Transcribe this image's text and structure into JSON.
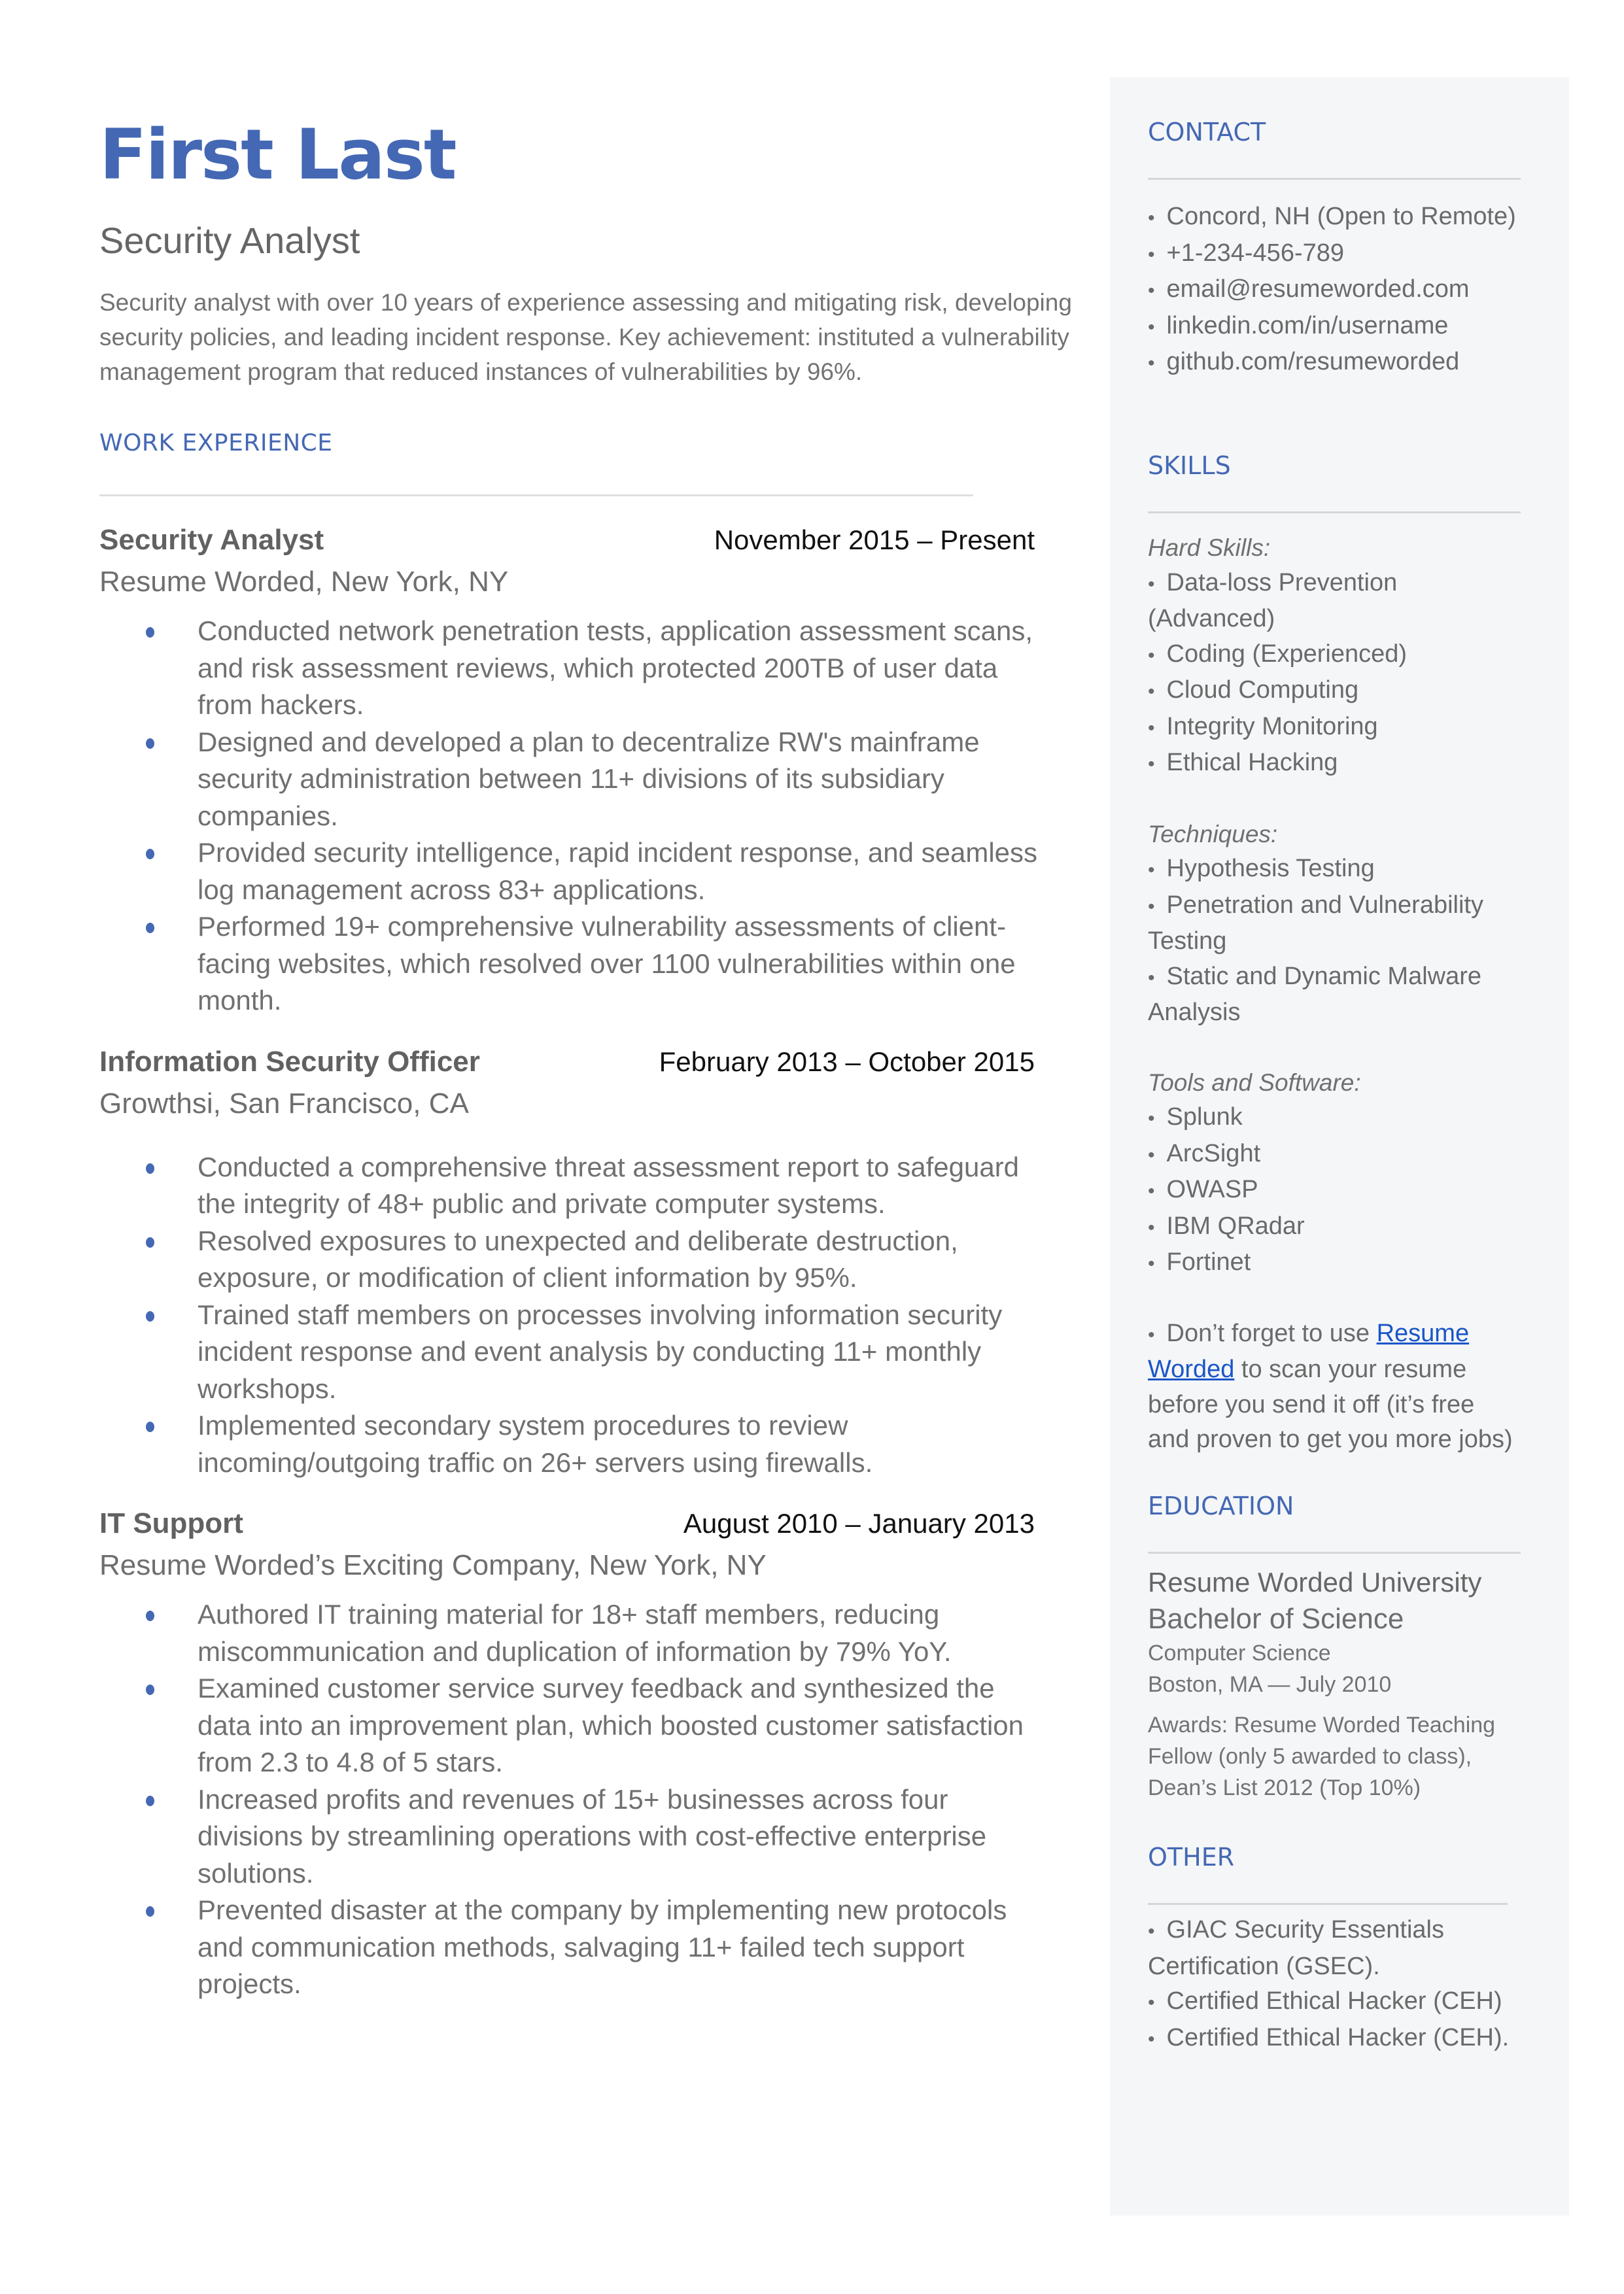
{
  "header": {
    "name": "First Last",
    "role": "Security Analyst",
    "summary": "Security analyst with over 10 years of experience assessing and mitigating risk, developing security policies, and leading incident response. Key achievement: instituted a vulnerability management program that reduced instances of vulnerabilities by 96%."
  },
  "colors": {
    "accent": "#4468b3",
    "sidebar_bg": "#f5f6f8",
    "link": "#1a56c8"
  },
  "work": {
    "title": "WORK EXPERIENCE",
    "jobs": [
      {
        "title": "Security Analyst",
        "dates": "November 2015 – Present",
        "company": "Resume Worded, New York, NY",
        "bullets": [
          "Conducted network penetration tests, application assessment scans, and risk assessment reviews, which protected 200TB of user data from hackers.",
          "Designed and developed a plan to decentralize RW's mainframe security administration between 11+ divisions of its subsidiary companies.",
          "Provided security intelligence, rapid incident response, and seamless log management across 83+ applications.",
          "Performed 19+ comprehensive vulnerability assessments of client-facing websites, which resolved over 1100 vulnerabilities within one month."
        ]
      },
      {
        "title": "Information Security Officer",
        "dates": "February 2013 – October 2015",
        "company": "Growthsi, San Francisco, CA",
        "bullets": [
          "Conducted a comprehensive threat assessment report to safeguard the integrity of 48+ public and private computer systems.",
          "Resolved exposures to unexpected and deliberate destruction, exposure, or modification of client information by 95%.",
          "Trained staff members on processes involving information security incident response and event analysis by conducting 11+ monthly workshops.",
          "Implemented secondary system procedures to review incoming/outgoing traffic on 26+ servers using firewalls."
        ]
      },
      {
        "title": "IT Support",
        "dates": "August 2010 – January 2013",
        "company": "Resume Worded’s Exciting Company, New York, NY",
        "bullets": [
          "Authored IT training material for 18+ staff members, reducing miscommunication and duplication of information by 79% YoY.",
          "Examined customer service survey feedback and synthesized the data into an improvement plan, which boosted customer satisfaction from 2.3 to 4.8 of 5 stars.",
          "Increased profits and revenues of 15+ businesses across four divisions by streamlining operations with cost-effective enterprise solutions.",
          "Prevented disaster at the company by implementing new protocols and communication methods, salvaging 11+ failed tech support projects."
        ]
      }
    ]
  },
  "contact": {
    "title": "CONTACT",
    "items": [
      "Concord, NH (Open to Remote)",
      "+1-234-456-789",
      "email@resumeworded.com",
      "linkedin.com/in/username",
      "github.com/resumeworded"
    ]
  },
  "skills": {
    "title": "SKILLS",
    "hard_label": "Hard Skills:",
    "hard": [
      "Data-loss Prevention (Advanced)",
      "Coding (Experienced)",
      "Cloud Computing",
      "Integrity Monitoring",
      "Ethical Hacking"
    ],
    "techniques_label": "Techniques:",
    "techniques": [
      "Hypothesis Testing",
      "Penetration and Vulnerability Testing",
      "Static and Dynamic Malware Analysis"
    ],
    "tools_label": "Tools and Software:",
    "tools": [
      "Splunk",
      "ArcSight",
      "OWASP",
      "IBM QRadar",
      "Fortinet"
    ],
    "tip_prefix": "Don’t forget to use ",
    "tip_link": "Resume Worded",
    "tip_suffix": " to scan your resume before you send it off (it’s free and proven to get you more jobs)"
  },
  "education": {
    "title": "EDUCATION",
    "school": "Resume Worded University",
    "degree": "Bachelor of Science",
    "field": "Computer Science",
    "location_date": "Boston, MA — July 2010",
    "awards": "Awards: Resume Worded Teaching Fellow (only 5 awarded to class), Dean’s List 2012 (Top 10%)"
  },
  "other": {
    "title": "OTHER",
    "items": [
      "GIAC Security Essentials Certification (GSEC).",
      "Certified Ethical Hacker (CEH)",
      "Certified Ethical Hacker (CEH)."
    ]
  }
}
